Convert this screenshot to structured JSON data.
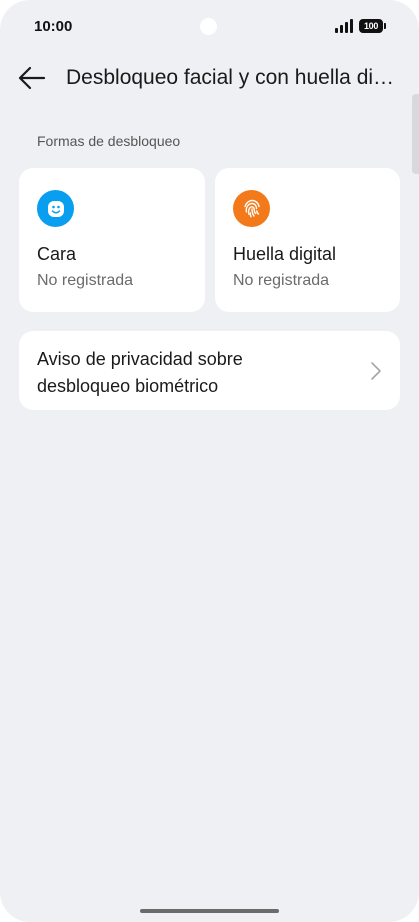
{
  "status_bar": {
    "time": "10:00",
    "battery": "100"
  },
  "header": {
    "title": "Desbloqueo facial y con huella digital",
    "back_icon": "arrow-left-icon"
  },
  "section": {
    "label": "Formas de desbloqueo"
  },
  "unlock_methods": [
    {
      "title": "Cara",
      "status": "No registrada",
      "icon": "face-icon",
      "color": "#0a9ef0"
    },
    {
      "title": "Huella digital",
      "status": "No registrada",
      "icon": "fingerprint-icon",
      "color": "#f27a1a"
    }
  ],
  "privacy": {
    "label": "Aviso de privacidad sobre desbloqueo biométrico",
    "icon": "chevron-right-icon"
  },
  "colors": {
    "background": "#eff0f3",
    "card": "#ffffff",
    "face_accent": "#0a9ef0",
    "finger_accent": "#f27a1a"
  }
}
